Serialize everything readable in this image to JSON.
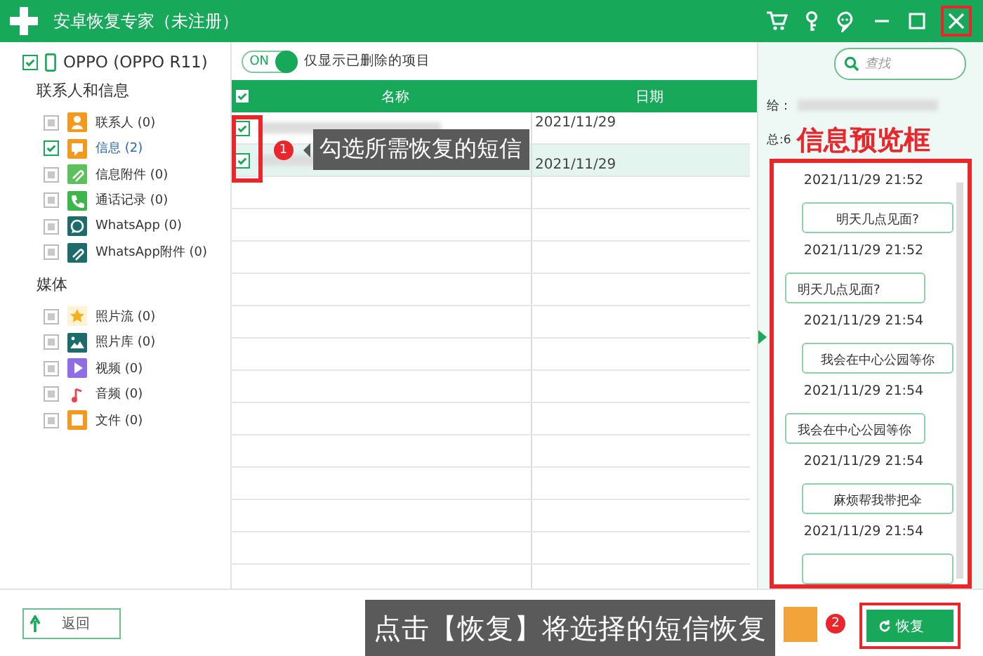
{
  "window": {
    "title": "安卓恢复专家（未注册）"
  },
  "device": {
    "name": "OPPO (OPPO R11)",
    "checked": true
  },
  "sidebar": {
    "groups": [
      {
        "title": "联系人和信息",
        "items": [
          {
            "label": "联系人 (0)",
            "kind": "contact",
            "checked": false,
            "selected": false
          },
          {
            "label": "信息 (2)",
            "kind": "message",
            "checked": true,
            "selected": true
          },
          {
            "label": "信息附件 (0)",
            "kind": "attachment",
            "checked": false,
            "selected": false
          },
          {
            "label": "通话记录 (0)",
            "kind": "call",
            "checked": false,
            "selected": false
          },
          {
            "label": "WhatsApp (0)",
            "kind": "whatsapp",
            "checked": false,
            "selected": false
          },
          {
            "label": "WhatsApp附件 (0)",
            "kind": "clip",
            "checked": false,
            "selected": false
          }
        ]
      },
      {
        "title": "媒体",
        "items": [
          {
            "label": "照片流 (0)",
            "kind": "star",
            "checked": false,
            "selected": false
          },
          {
            "label": "照片库 (0)",
            "kind": "gallery",
            "checked": false,
            "selected": false
          },
          {
            "label": "视频 (0)",
            "kind": "video",
            "checked": false,
            "selected": false
          },
          {
            "label": "音频 (0)",
            "kind": "audio",
            "checked": false,
            "selected": false
          },
          {
            "label": "文件 (0)",
            "kind": "file",
            "checked": false,
            "selected": false
          }
        ]
      }
    ]
  },
  "filter": {
    "toggle_text": "ON",
    "on": true,
    "label": "仅显示已删除的项目"
  },
  "search": {
    "placeholder": "查找"
  },
  "table": {
    "all_checked": true,
    "columns": [
      "名称",
      "日期"
    ],
    "rows": [
      {
        "checked": true,
        "date": "2021/11/29"
      },
      {
        "checked": true,
        "date": "2021/11/29"
      }
    ]
  },
  "callout_1": {
    "badge": "1",
    "text": "勾选所需恢复的短信"
  },
  "preview": {
    "to_label": "给：",
    "total": "总:6",
    "annotation": "信息预览框",
    "messages": [
      {
        "time": "2021/11/29 21:52",
        "text": "明天几点见面?",
        "kind": "sent"
      },
      {
        "time": "2021/11/29 21:52",
        "text": "明天几点见面?",
        "kind": "received"
      },
      {
        "time": "2021/11/29 21:54",
        "text": "我会在中心公园等你",
        "kind": "sent"
      },
      {
        "time": "2021/11/29 21:54",
        "text": "我会在中心公园等你",
        "kind": "received"
      },
      {
        "time": "2021/11/29 21:54",
        "text": "麻烦帮我带把伞",
        "kind": "sent"
      },
      {
        "time": "2021/11/29 21:54",
        "kind": "sent"
      }
    ]
  },
  "bottom": {
    "back": "返回",
    "callout_2": {
      "badge": "2",
      "text": "点击【恢复】将选择的短信恢复"
    },
    "restore": "恢复"
  }
}
